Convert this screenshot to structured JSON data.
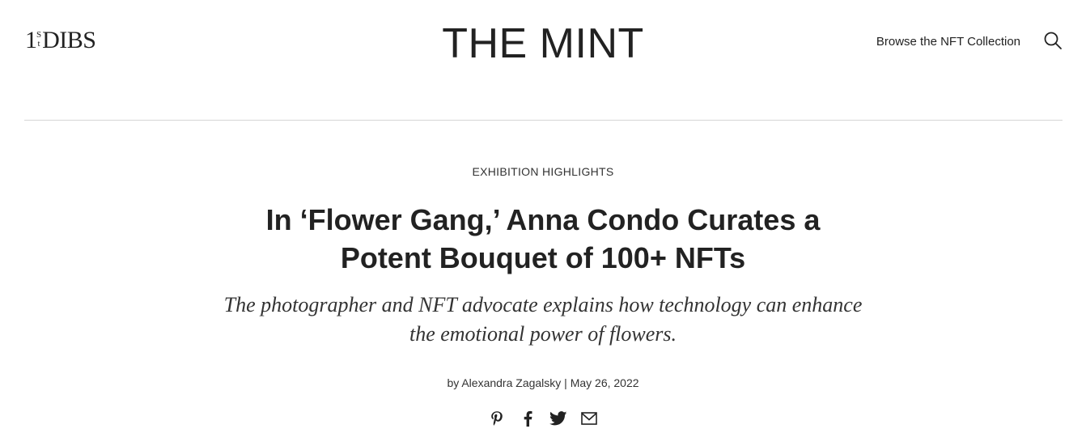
{
  "header": {
    "logo": {
      "num": "1",
      "sup_top": "S",
      "sup_bottom": "t",
      "word": "DIBS"
    },
    "site_title": "THE MINT",
    "browse_link": "Browse the NFT Collection",
    "search_icon": "search-icon"
  },
  "article": {
    "category": "EXHIBITION HIGHLIGHTS",
    "headline": "In ‘Flower Gang,’ Anna Condo Curates a Potent Bouquet of 100+ NFTs",
    "dek": "The photographer and NFT advocate explains how technology can enhance the emotional power of flowers.",
    "byline": "by Alexandra Zagalsky | May 26, 2022",
    "share_icons": [
      "pinterest-icon",
      "facebook-icon",
      "twitter-icon",
      "email-icon"
    ]
  }
}
